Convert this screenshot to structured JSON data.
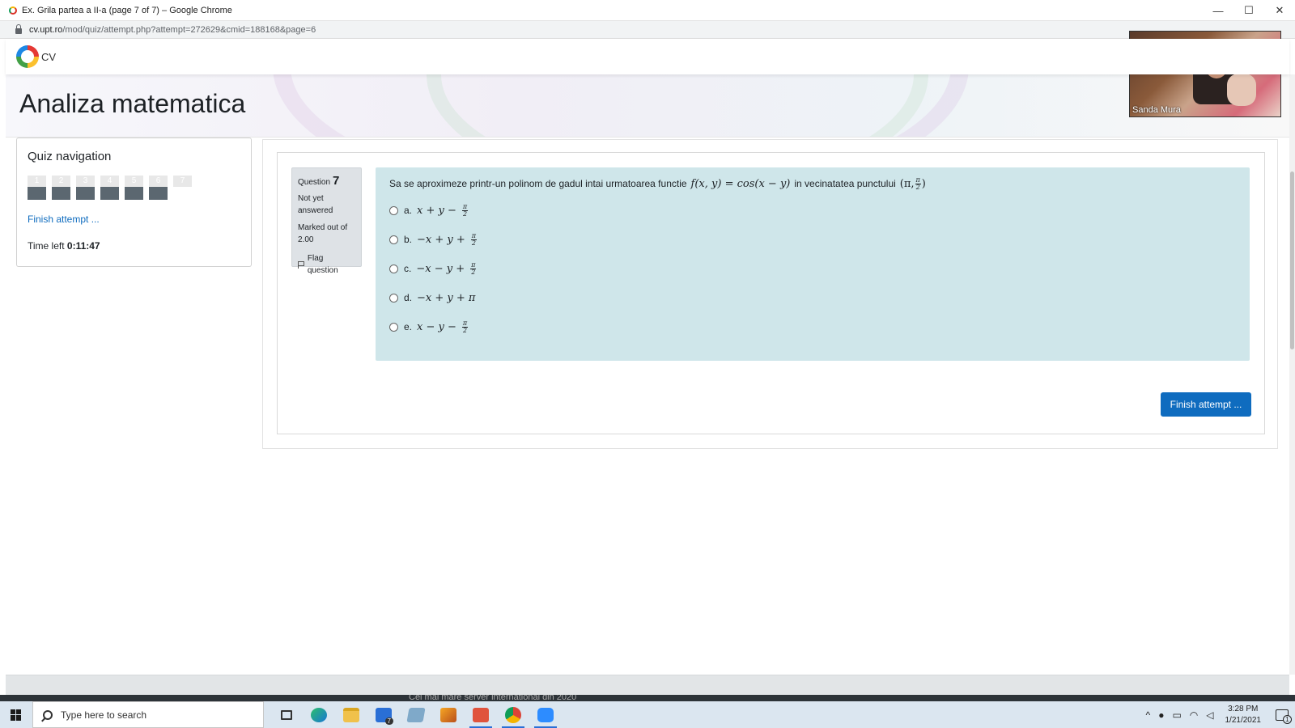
{
  "window": {
    "title": "Ex. Grila partea a II-a (page 7 of 7) – Google Chrome",
    "controls": {
      "minimize": "—",
      "maximize": "☐",
      "close": "✕"
    }
  },
  "address_bar": {
    "host": "cv.upt.ro",
    "path": "/mod/quiz/attempt.php?attempt=272629&cmid=188168&page=6"
  },
  "site": {
    "name": "CV"
  },
  "page": {
    "title": "Analiza matematica"
  },
  "quiz_nav": {
    "heading": "Quiz navigation",
    "buttons": [
      {
        "num": "1",
        "state": "answered"
      },
      {
        "num": "2",
        "state": "answered"
      },
      {
        "num": "3",
        "state": "answered"
      },
      {
        "num": "4",
        "state": "answered"
      },
      {
        "num": "5",
        "state": "answered"
      },
      {
        "num": "6",
        "state": "answered"
      },
      {
        "num": "7",
        "state": "current"
      }
    ],
    "finish_link": "Finish attempt ...",
    "time_left_label": "Time left",
    "time_left_value": "0:11:47"
  },
  "question": {
    "label": "Question",
    "number": "7",
    "state": "Not yet answered",
    "grade": "Marked out of 2.00",
    "flag": "Flag question",
    "text_before": "Sa se aproximeze printr-un polinom de gadul intai urmatoarea functie",
    "function_math": "f(x, y) = cos(x − y)",
    "text_middle": "in vecinatatea punctului",
    "point_open": "(π,",
    "point_frac_num": "π",
    "point_frac_den": "2",
    "point_close": ")",
    "answers": [
      {
        "letter": "a.",
        "math": "x + y −",
        "frac_num": "π",
        "frac_den": "2"
      },
      {
        "letter": "b.",
        "math": "−x + y +",
        "frac_num": "π",
        "frac_den": "2"
      },
      {
        "letter": "c.",
        "math": "−x − y +",
        "frac_num": "π",
        "frac_den": "2"
      },
      {
        "letter": "d.",
        "math": "−x + y + π",
        "frac_num": "",
        "frac_den": ""
      },
      {
        "letter": "e.",
        "math": "x − y −",
        "frac_num": "π",
        "frac_den": "2"
      }
    ]
  },
  "finish_button": "Finish attempt ...",
  "footer": {
    "text": "Cel mai mare server international din 2020"
  },
  "webcam": {
    "name": "Sanda Mura"
  },
  "taskbar": {
    "search_placeholder": "Type here to search",
    "mail_badge": "7",
    "time": "3:28 PM",
    "date": "1/21/2021",
    "notif_count": "1"
  }
}
